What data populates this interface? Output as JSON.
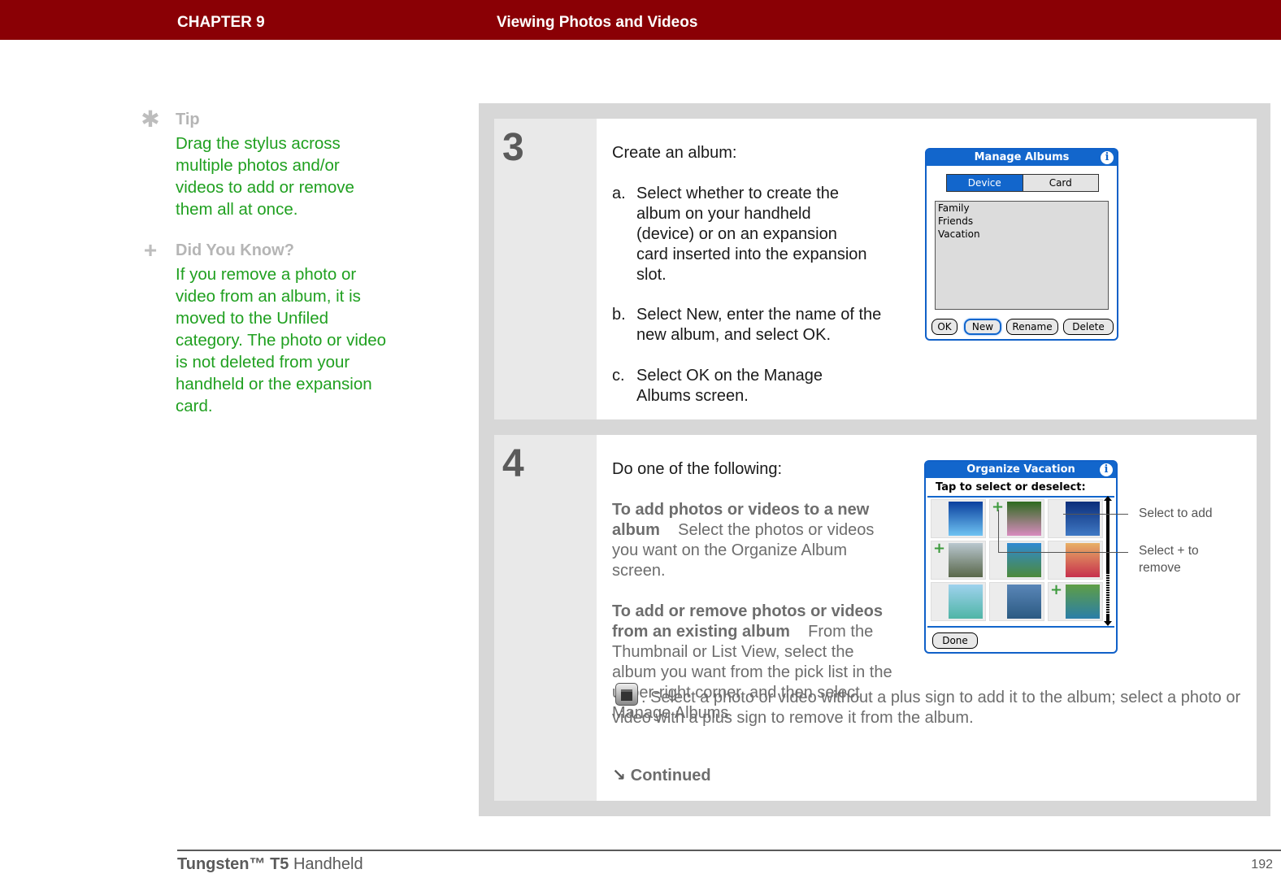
{
  "header": {
    "chapter": "CHAPTER 9",
    "title": "Viewing Photos and Videos"
  },
  "sidebar": {
    "tip": {
      "icon": "asterisk-icon",
      "heading": "Tip",
      "body": "Drag the stylus across multiple photos and/or videos to add or remove them all at once."
    },
    "did_you_know": {
      "icon": "plus-icon",
      "heading": "Did You Know?",
      "body": "If you remove a photo or video from an album, it is moved to the Unfiled category. The photo or video is not deleted from your handheld or the expansion card."
    }
  },
  "steps": [
    {
      "number": "3",
      "intro": "Create an album:",
      "items": [
        {
          "marker": "a.",
          "text": "Select whether to create the album on your handheld (device) or on an expansion card inserted into the expansion slot."
        },
        {
          "marker": "b.",
          "text": "Select New, enter the name of the new album, and select OK."
        },
        {
          "marker": "c.",
          "text": "Select OK on the Manage Albums screen."
        }
      ],
      "screen": {
        "title": "Manage Albums",
        "info_icon": "info-icon",
        "tabs": [
          {
            "label": "Device",
            "selected": true
          },
          {
            "label": "Card",
            "selected": false
          }
        ],
        "albums": [
          "Family",
          "Friends",
          "Vacation"
        ],
        "buttons": [
          {
            "label": "OK",
            "selected": false
          },
          {
            "label": "New",
            "selected": true
          },
          {
            "label": "Rename",
            "selected": false
          },
          {
            "label": "Delete",
            "selected": false
          }
        ]
      }
    },
    {
      "number": "4",
      "intro": "Do one of the following:",
      "option1_heading": "To add photos or videos to a new album",
      "option1_text": "Select the photos or videos you want on the Organize Album screen.",
      "option2_heading": "To add or remove photos or videos from an existing album",
      "option2_text_a": "From the Thumbnail or List View, select the album you want from the pick list in the upper-right corner, and then select Manage Albums",
      "option2_text_b": ". Select a photo or video without a plus sign to add it to the album; select a photo or video with a plus sign to remove it from the album.",
      "manage_albums_icon": "manage-albums-icon",
      "continued": "Continued",
      "continued_icon": "arrow-down-right-icon",
      "screen": {
        "title": "Organize Vacation",
        "info_icon": "info-icon",
        "subtitle": "Tap to select or deselect:",
        "thumbnails": [
          {
            "subject": "blue sky",
            "plus": false,
            "colors": [
              "#0a3f9e",
              "#6fc3f2"
            ]
          },
          {
            "subject": "pink flowers",
            "plus": true,
            "colors": [
              "#2e6b1f",
              "#d98bbf"
            ]
          },
          {
            "subject": "blue water",
            "plus": false,
            "colors": [
              "#0b2d7a",
              "#3f79c4"
            ]
          },
          {
            "subject": "tree branches",
            "plus": true,
            "colors": [
              "#b9c7cf",
              "#59674a"
            ]
          },
          {
            "subject": "lake and people",
            "plus": false,
            "colors": [
              "#2f8ad2",
              "#4d8a3b"
            ]
          },
          {
            "subject": "two friends",
            "plus": false,
            "colors": [
              "#e8b066",
              "#c7304d"
            ]
          },
          {
            "subject": "ocean horizon",
            "plus": false,
            "colors": [
              "#9fd2ee",
              "#4fb5a6"
            ]
          },
          {
            "subject": "calm sea",
            "plus": false,
            "colors": [
              "#5a86b8",
              "#2b5a82"
            ]
          },
          {
            "subject": "green hills",
            "plus": true,
            "colors": [
              "#5f9e45",
              "#2b7ea8"
            ]
          }
        ],
        "done_label": "Done"
      },
      "callouts": [
        "Select to add",
        "Select + to remove"
      ]
    }
  ],
  "footer": {
    "product_bold": "Tungsten™ T5",
    "product_rest": " Handheld",
    "page_number": "192"
  }
}
